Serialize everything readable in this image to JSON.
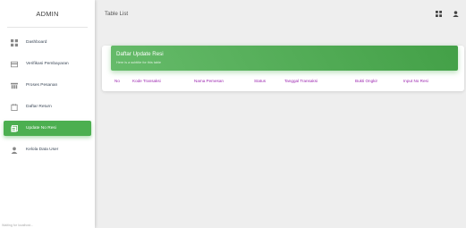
{
  "sidebar": {
    "brand": "ADMIN",
    "items": [
      {
        "label": "Dashboard",
        "icon": "dashboard-icon",
        "active": false
      },
      {
        "label": "Verifikasi Pembayaran",
        "icon": "payment-icon",
        "active": false
      },
      {
        "label": "Proses Pesanan",
        "icon": "process-icon",
        "active": false
      },
      {
        "label": "Daftar Return",
        "icon": "return-icon",
        "active": false
      },
      {
        "label": "Update No Resi",
        "icon": "receipt-icon",
        "active": true
      },
      {
        "label": "Kelola Data User",
        "icon": "user-icon",
        "active": false
      }
    ],
    "footer": "Waiting for localhost..."
  },
  "topbar": {
    "title": "Table List",
    "icons": [
      "grid-icon",
      "person-icon"
    ]
  },
  "card": {
    "title": "Daftar Update Resi",
    "subtitle": "Here is a subtitle for this table",
    "columns": [
      "No",
      "Kode Transaksi",
      "Nama Pemesan",
      "Status",
      "Tanggal Transaksi",
      "Bukti Ongkir",
      "Input No Resi"
    ]
  },
  "colors": {
    "accent": "#4caf50",
    "column_header": "#9c27b0",
    "background": "#eeeeee"
  }
}
